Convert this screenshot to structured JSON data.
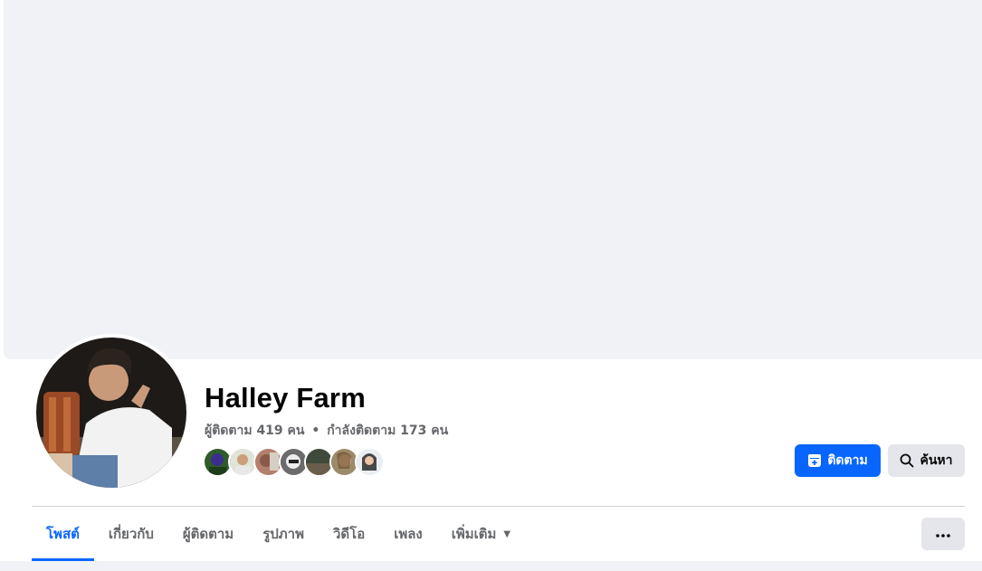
{
  "profile": {
    "name": "Halley Farm",
    "followers_text": "ผู้ติดตาม 419 คน",
    "separator": "•",
    "following_text": "กำลังติดตาม 173 คน"
  },
  "actions": {
    "follow_label": "ติดตาม",
    "search_label": "ค้นหา"
  },
  "tabs": [
    {
      "label": "โพสต์",
      "active": true
    },
    {
      "label": "เกี่ยวกับ",
      "active": false
    },
    {
      "label": "ผู้ติดตาม",
      "active": false
    },
    {
      "label": "รูปภาพ",
      "active": false
    },
    {
      "label": "วิดีโอ",
      "active": false
    },
    {
      "label": "เพลง",
      "active": false
    },
    {
      "label": "เพิ่มเติม",
      "active": false
    }
  ],
  "icons": {
    "follow": "add-follow-icon",
    "search": "search-icon",
    "more_tab": "caret-down-icon",
    "more_button": "more-horizontal-icon"
  },
  "colors": {
    "accent": "#0866ff",
    "cover": "#f0f2f5",
    "secondary_text": "#65676b",
    "button_gray": "#e4e6eb"
  }
}
